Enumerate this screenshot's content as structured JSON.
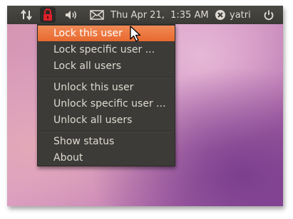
{
  "panel": {
    "network_icon": "network-updown-icon",
    "lock_icon": "padlock-icon",
    "volume_icon": "speaker-icon",
    "mail_icon": "envelope-icon",
    "clock": "Thu Apr 21,  1:35 AM",
    "user_status_icon": "user-status-icon",
    "username": "yatri",
    "power_icon": "power-icon"
  },
  "menu": {
    "items": [
      {
        "label": "Lock this user",
        "highlighted": true
      },
      {
        "label": "Lock specific user ..."
      },
      {
        "label": "Lock all users"
      },
      {
        "label": "Unlock this user"
      },
      {
        "label": "Unlock specific user ..."
      },
      {
        "label": "Unlock all users"
      },
      {
        "label": "Show status"
      },
      {
        "label": "About"
      }
    ]
  },
  "colors": {
    "highlight": "#e8692f",
    "panel": "#3c3b37",
    "lock_red": "#e0202a"
  }
}
